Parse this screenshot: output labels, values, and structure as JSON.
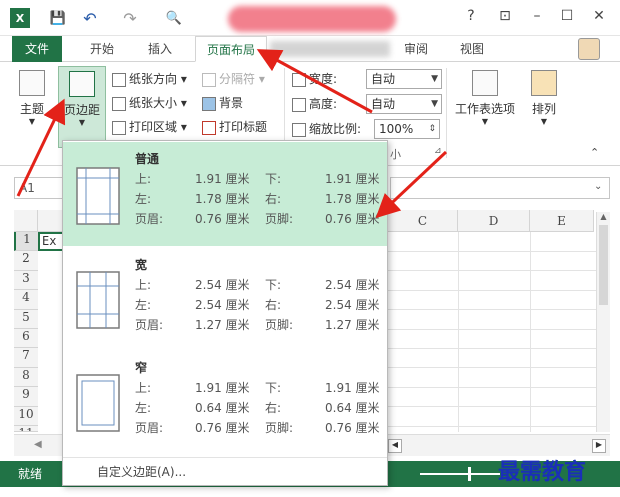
{
  "qat": {
    "save": "💾",
    "undo": "↶",
    "redo": "↷",
    "preview": "🔍"
  },
  "window": {
    "help": "?",
    "restore": "⊡",
    "minimize": "–",
    "maximize": "☐",
    "close": "✕"
  },
  "tabs": {
    "file": "文件",
    "home": "开始",
    "insert": "插入",
    "page_layout": "页面布局",
    "review": "审阅",
    "view": "视图"
  },
  "ribbon": {
    "theme": "主题",
    "margins": "页边距",
    "orientation": "纸张方向",
    "size": "纸张大小",
    "print_area": "打印区域",
    "breaks": "分隔符",
    "background": "背景",
    "print_titles": "打印标题",
    "width_label": "宽度:",
    "width_value": "自动",
    "height_label": "高度:",
    "height_value": "自动",
    "scale_label": "缩放比例:",
    "scale_value": "100%",
    "group_label_fragment": "小",
    "sheet_options": "工作表选项",
    "arrange": "排列"
  },
  "formula": {
    "name_box": "A1"
  },
  "sheet": {
    "columns": [
      "C",
      "D",
      "E"
    ],
    "rows": [
      "1",
      "2",
      "3",
      "4",
      "5",
      "6",
      "7",
      "8",
      "9",
      "10",
      "11"
    ],
    "cell_a1": "Ex"
  },
  "margins_menu": {
    "options": [
      {
        "name": "普通",
        "top_label": "上:",
        "top": "1.91 厘米",
        "bottom_label": "下:",
        "bottom": "1.91 厘米",
        "left_label": "左:",
        "left": "1.78 厘米",
        "right_label": "右:",
        "right": "1.78 厘米",
        "header_label": "页眉:",
        "header": "0.76 厘米",
        "footer_label": "页脚:",
        "footer": "0.76 厘米",
        "selected": true
      },
      {
        "name": "宽",
        "top_label": "上:",
        "top": "2.54 厘米",
        "bottom_label": "下:",
        "bottom": "2.54 厘米",
        "left_label": "左:",
        "left": "2.54 厘米",
        "right_label": "右:",
        "right": "2.54 厘米",
        "header_label": "页眉:",
        "header": "1.27 厘米",
        "footer_label": "页脚:",
        "footer": "1.27 厘米",
        "selected": false
      },
      {
        "name": "窄",
        "top_label": "上:",
        "top": "1.91 厘米",
        "bottom_label": "下:",
        "bottom": "1.91 厘米",
        "left_label": "左:",
        "left": "0.64 厘米",
        "right_label": "右:",
        "right": "0.64 厘米",
        "header_label": "页眉:",
        "header": "0.76 厘米",
        "footer_label": "页脚:",
        "footer": "0.76 厘米",
        "selected": false
      }
    ],
    "custom": "自定义边距(A)..."
  },
  "status": {
    "ready": "就绪"
  },
  "watermark": "最需教育",
  "colors": {
    "accent": "#217346",
    "selected_bg": "#c7ecd6",
    "arrow": "#e32219"
  }
}
